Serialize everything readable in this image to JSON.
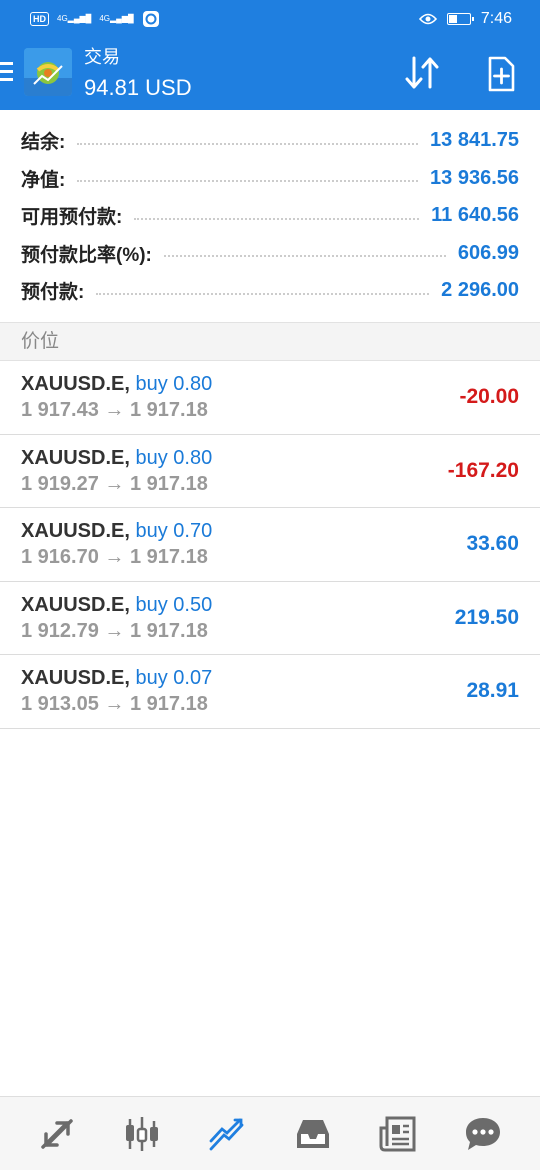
{
  "status_bar": {
    "network_tag": "HD",
    "signal_1": "4G",
    "signal_2": "4G",
    "time": "7:46",
    "battery_level": 0.35
  },
  "header": {
    "title": "交易",
    "subtitle": "94.81 USD",
    "accent_color": "#1f7fe0"
  },
  "summary": [
    {
      "label": "结余:",
      "value": "13 841.75"
    },
    {
      "label": "净值:",
      "value": "13 936.56"
    },
    {
      "label": "可用预付款:",
      "value": "11 640.56"
    },
    {
      "label": "预付款比率(%):",
      "value": "606.99"
    },
    {
      "label": "预付款:",
      "value": "2 296.00"
    }
  ],
  "section_title": "价位",
  "positions": [
    {
      "symbol": "XAUUSD.E,",
      "direction": "buy 0.80",
      "prices": "1 917.43 → 1 917.18",
      "profit": "-20.00",
      "negative": true
    },
    {
      "symbol": "XAUUSD.E,",
      "direction": "buy 0.80",
      "prices": "1 919.27 → 1 917.18",
      "profit": "-167.20",
      "negative": true
    },
    {
      "symbol": "XAUUSD.E,",
      "direction": "buy 0.70",
      "prices": "1 916.70 → 1 917.18",
      "profit": "33.60",
      "negative": false
    },
    {
      "symbol": "XAUUSD.E,",
      "direction": "buy 0.50",
      "prices": "1 912.79 → 1 917.18",
      "profit": "219.50",
      "negative": false
    },
    {
      "symbol": "XAUUSD.E,",
      "direction": "buy 0.07",
      "prices": "1 913.05 → 1 917.18",
      "profit": "28.91",
      "negative": false
    }
  ],
  "bottom_nav": [
    {
      "icon": "quotes-icon",
      "active": false
    },
    {
      "icon": "chart-icon",
      "active": false
    },
    {
      "icon": "trade-icon",
      "active": true
    },
    {
      "icon": "history-icon",
      "active": false
    },
    {
      "icon": "news-icon",
      "active": false
    },
    {
      "icon": "chat-icon",
      "active": false
    }
  ]
}
